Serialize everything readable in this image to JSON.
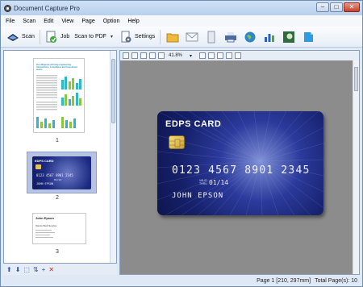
{
  "window": {
    "title": "Document Capture Pro",
    "minimize": "–",
    "maximize": "□",
    "close": "✕"
  },
  "menu": [
    "File",
    "Scan",
    "Edit",
    "View",
    "Page",
    "Option",
    "Help"
  ],
  "toolbar": {
    "scan_label": "Scan",
    "job_label": "Job",
    "job_value": "Scan to PDF",
    "settings_label": "Settings",
    "arrow": "▾"
  },
  "view_toolbar": {
    "zoom_value": "41.8%",
    "arrow": "▾"
  },
  "thumbnails": [
    {
      "page": "1",
      "heading": "Our diligence will help engineering transactions, compliance and investment teams"
    },
    {
      "page": "2",
      "title": "EDPS CARD",
      "number": "0123 4567 8901 2345",
      "valid": "01/14",
      "holder": "JOHN EPSON"
    },
    {
      "page": "3",
      "name": "John Epson",
      "company": "Viento Web Service"
    }
  ],
  "card": {
    "title": "EDPS CARD",
    "number": "0123 4567 8901 2345",
    "valid_label": "VALID THRU",
    "valid_date": "01/14",
    "holder": "JOHN EPSON"
  },
  "status": {
    "page_info": "Page 1 [210, 297mm]",
    "total_pages": "Total Page(s): 10"
  },
  "colors": {
    "card_dark": "#15206a",
    "card_light": "#7d8ed6",
    "selection": "#b7c3e3",
    "viewer_bg": "#8c8c8c"
  },
  "icons": [
    "scan-icon",
    "job-icon",
    "settings-icon",
    "folder-icon",
    "mail-icon",
    "document-icon",
    "printer-icon",
    "web-icon",
    "chart-icon",
    "image-icon",
    "cloud-icon"
  ]
}
